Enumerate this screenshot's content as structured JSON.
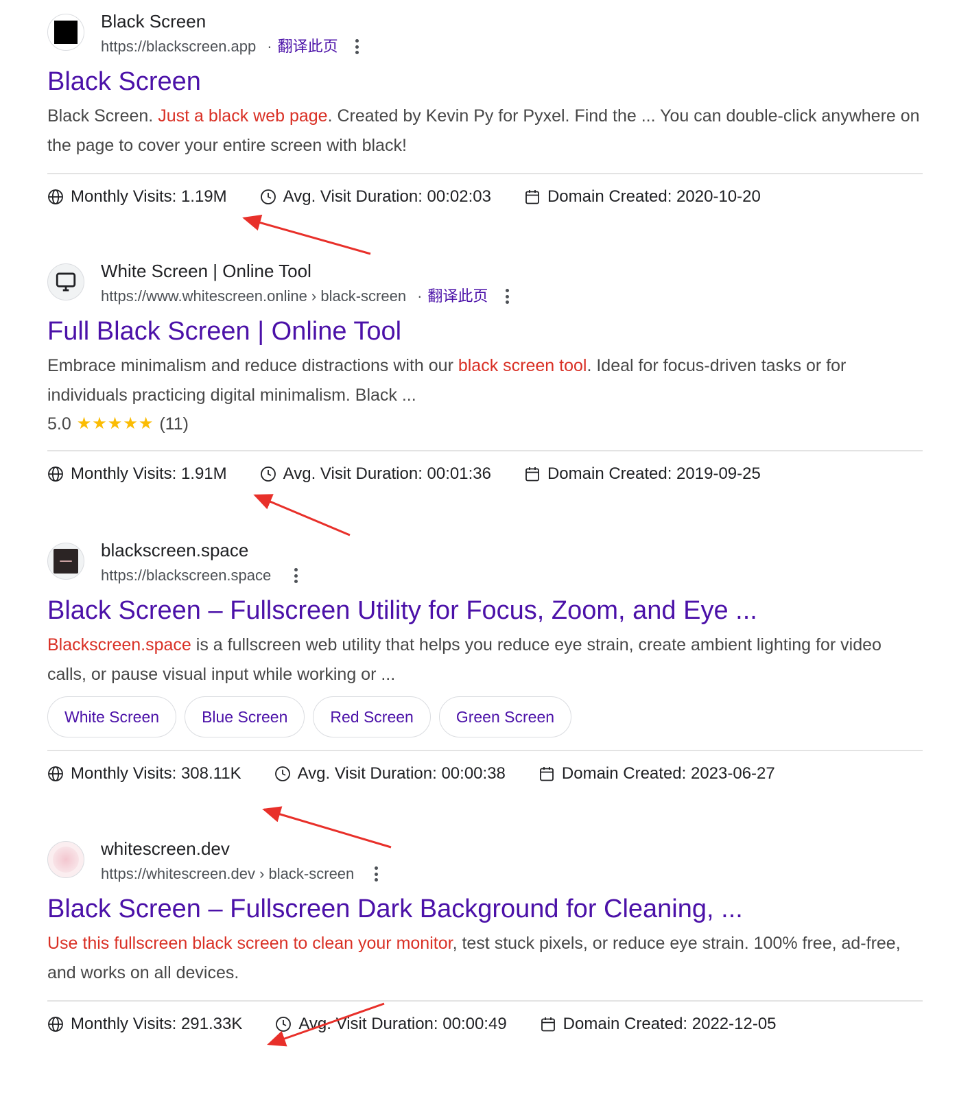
{
  "results": [
    {
      "site_name": "Black Screen",
      "url": "https://blackscreen.app",
      "translate": "翻译此页",
      "title": "Black Screen",
      "snippet_pre": "Black Screen. ",
      "snippet_hl": "Just a black web page",
      "snippet_post": ". Created by Kevin Py for Pyxel. Find the ... You can double-click anywhere on the page to cover your entire screen with black!",
      "metrics": {
        "visits": "Monthly Visits: 1.19M",
        "duration": "Avg. Visit Duration: 00:02:03",
        "created": "Domain Created: 2020-10-20"
      }
    },
    {
      "site_name": "White Screen | Online Tool",
      "url": "https://www.whitescreen.online › black-screen",
      "translate": "翻译此页",
      "title": "Full Black Screen | Online Tool",
      "snippet_pre": "Embrace minimalism and reduce distractions with our ",
      "snippet_hl": "black screen tool",
      "snippet_post": ". Ideal for focus-driven tasks or for individuals practicing digital minimalism. Black ...",
      "rating": {
        "score": "5.0",
        "stars": "★★★★★",
        "count": "(11)"
      },
      "metrics": {
        "visits": "Monthly Visits: 1.91M",
        "duration": "Avg. Visit Duration: 00:01:36",
        "created": "Domain Created: 2019-09-25"
      }
    },
    {
      "site_name": "blackscreen.space",
      "url": "https://blackscreen.space",
      "title": "Black Screen – Fullscreen Utility for Focus, Zoom, and Eye ...",
      "snippet_pre": "",
      "snippet_hl": "Blackscreen.space",
      "snippet_post": " is a fullscreen web utility that helps you reduce eye strain, create ambient lighting for video calls, or pause visual input while working or ...",
      "chips": [
        "White Screen",
        "Blue Screen",
        "Red Screen",
        "Green Screen"
      ],
      "metrics": {
        "visits": "Monthly Visits: 308.11K",
        "duration": "Avg. Visit Duration: 00:00:38",
        "created": "Domain Created: 2023-06-27"
      }
    },
    {
      "site_name": "whitescreen.dev",
      "url": "https://whitescreen.dev › black-screen",
      "title": "Black Screen – Fullscreen Dark Background for Cleaning, ...",
      "snippet_pre": "",
      "snippet_hl": "Use this fullscreen black screen to clean your monitor",
      "snippet_post": ", test stuck pixels, or reduce eye strain. 100% free, ad-free, and works on all devices.",
      "metrics": {
        "visits": "Monthly Visits: 291.33K",
        "duration": "Avg. Visit Duration: 00:00:49",
        "created": "Domain Created: 2022-12-05"
      }
    }
  ],
  "colors": {
    "link": "#4b11a8",
    "highlight": "#d93025",
    "star": "#fbbc04",
    "annotation_arrow": "#e8302a"
  },
  "icons": [
    "globe-icon",
    "clock-icon",
    "calendar-icon",
    "more-vert-icon",
    "monitor-icon"
  ]
}
